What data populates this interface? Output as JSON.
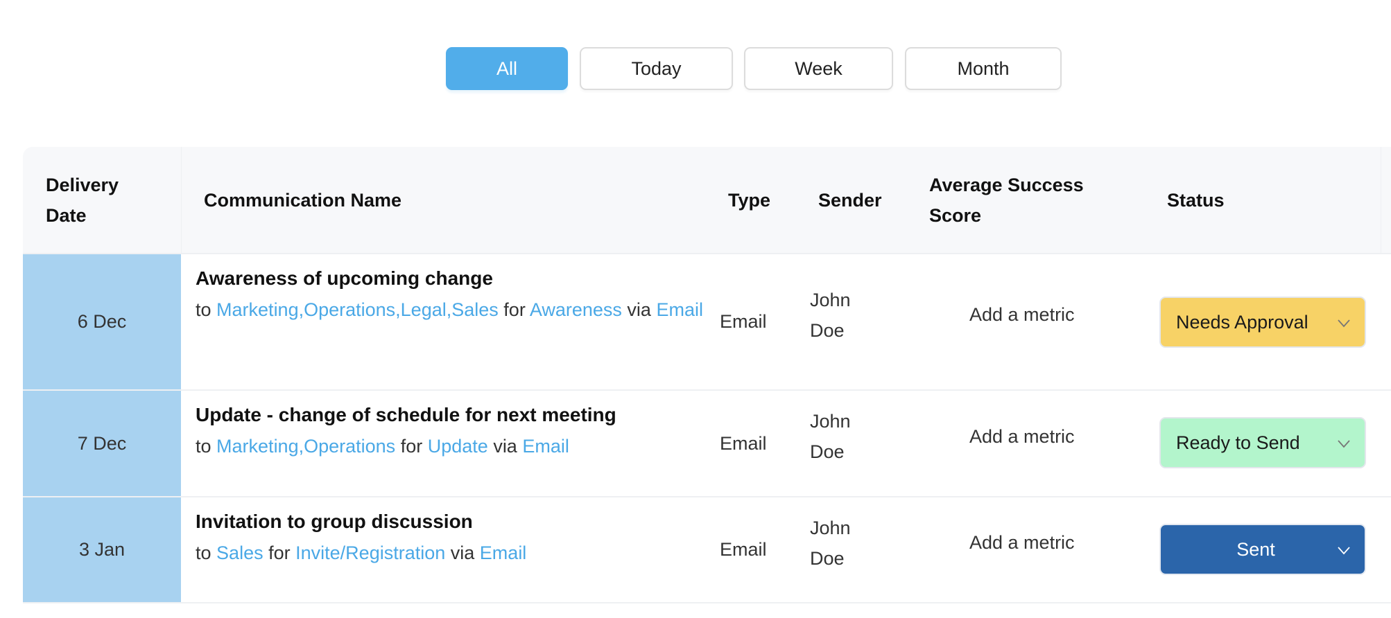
{
  "filters": {
    "options": [
      {
        "label": "All",
        "active": true
      },
      {
        "label": "Today",
        "active": false
      },
      {
        "label": "Week",
        "active": false
      },
      {
        "label": "Month",
        "active": false
      }
    ]
  },
  "table": {
    "headers": {
      "delivery_date": "Delivery Date",
      "communication_name": "Communication Name",
      "type": "Type",
      "sender": "Sender",
      "average_success_score": "Average Success Score",
      "status": "Status"
    },
    "rows": [
      {
        "date": "6 Dec",
        "title": "Awareness of upcoming change",
        "to_word": "to",
        "recipients": "Marketing,Operations,Legal,Sales",
        "for_word": "for",
        "purpose": "Awareness",
        "via_word": "via",
        "channel": "Email",
        "type": "Email",
        "sender": "John Doe",
        "metric": "Add a metric",
        "status": "Needs Approval",
        "status_bg": "#f7d266",
        "status_fg": "#1a1a1a",
        "chevron_color": "#777777"
      },
      {
        "date": "7 Dec",
        "title": "Update - change of schedule for next meeting",
        "to_word": "to",
        "recipients": "Marketing,Operations",
        "for_word": "for",
        "purpose": "Update",
        "via_word": "via",
        "channel": "Email",
        "type": "Email",
        "sender": "John Doe",
        "metric": "Add a metric",
        "status": "Ready to Send",
        "status_bg": "#b3f5cc",
        "status_fg": "#1a1a1a",
        "chevron_color": "#777777"
      },
      {
        "date": "3 Jan",
        "title": "Invitation to group discussion",
        "to_word": "to",
        "recipients": "Sales",
        "for_word": "for",
        "purpose": "Invite/Registration",
        "via_word": "via",
        "channel": "Email",
        "type": "Email",
        "sender": "John Doe",
        "metric": "Add a metric",
        "status": "Sent",
        "status_bg": "#2b65aa",
        "status_fg": "#ffffff",
        "chevron_color": "#ffffff"
      }
    ]
  },
  "colors": {
    "accent": "#51adea",
    "link": "#4aa8e6",
    "date_column": "#a8d2f0",
    "header_bg": "#f7f8fa"
  }
}
